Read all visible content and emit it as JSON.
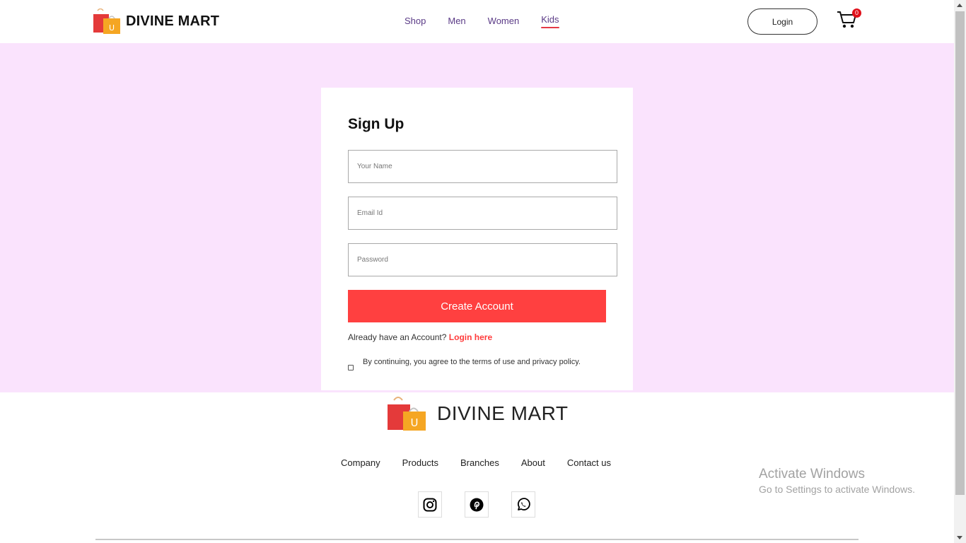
{
  "header": {
    "brand": "DIVINE MART",
    "nav": [
      "Shop",
      "Men",
      "Women",
      "Kids"
    ],
    "active_nav": "Kids",
    "login_label": "Login",
    "cart_count": "0",
    "logo_letter": "U"
  },
  "signup": {
    "title": "Sign Up",
    "name_placeholder": "Your Name",
    "email_placeholder": "Email Id",
    "password_placeholder": "Password",
    "create_label": "Create Account",
    "already_text": "Already have an Account?",
    "login_here": "Login here",
    "agree_text": "By continuing, you agree to the terms of use and privacy policy."
  },
  "footer": {
    "brand": "DIVINE MART",
    "links": [
      "Company",
      "Products",
      "Branches",
      "About",
      "Contact us"
    ],
    "social": [
      "instagram-icon",
      "pinterest-icon",
      "whatsapp-icon"
    ]
  },
  "watermark": {
    "title": "Activate Windows",
    "subtitle": "Go to Settings to activate Windows."
  },
  "colors": {
    "accent": "#ff4040",
    "band": "#fae3fd",
    "nav_text": "#5a3a86"
  }
}
